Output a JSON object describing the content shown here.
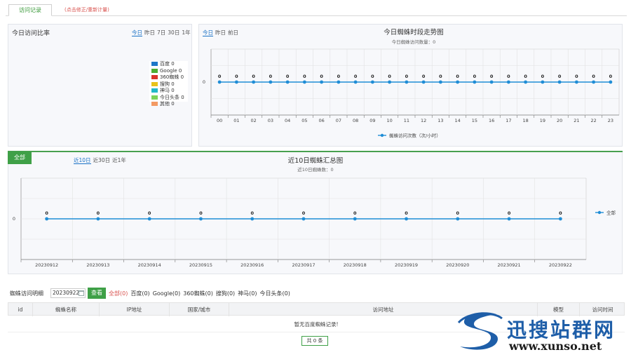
{
  "tabs": {
    "active": "访问记录",
    "link": "(点击修正/重新计量)"
  },
  "ratio": {
    "title": "今日访问比率",
    "range": [
      "今日",
      "昨日",
      "7日",
      "30日",
      "1年"
    ],
    "range_active": 0,
    "legend": [
      {
        "label": "百度 0",
        "color": "#1f78c8"
      },
      {
        "label": "Google 0",
        "color": "#4cae33"
      },
      {
        "label": "360蜘蛛 0",
        "color": "#d9342b"
      },
      {
        "label": "搜狗 0",
        "color": "#e8c21b"
      },
      {
        "label": "神马 0",
        "color": "#23b8c8"
      },
      {
        "label": "今日头条 0",
        "color": "#7dd35a"
      },
      {
        "label": "其他 0",
        "color": "#f39a63"
      }
    ]
  },
  "hourly": {
    "range": [
      "今日",
      "昨日",
      "前日"
    ],
    "range_active": 0,
    "chart_data": {
      "type": "line",
      "title": "今日蜘蛛时段走势图",
      "subtitle": "今日蜘蛛访问数量：0",
      "categories": [
        "00",
        "01",
        "02",
        "03",
        "04",
        "05",
        "06",
        "07",
        "08",
        "09",
        "10",
        "11",
        "12",
        "13",
        "14",
        "15",
        "16",
        "17",
        "18",
        "19",
        "20",
        "21",
        "22",
        "23"
      ],
      "series": [
        {
          "name": "蜘蛛访问次数（次/小时）",
          "values": [
            0,
            0,
            0,
            0,
            0,
            0,
            0,
            0,
            0,
            0,
            0,
            0,
            0,
            0,
            0,
            0,
            0,
            0,
            0,
            0,
            0,
            0,
            0,
            0
          ]
        }
      ],
      "yticks": [
        "0"
      ],
      "color": "#1f8dd6"
    }
  },
  "daily": {
    "tab": "全部",
    "range": [
      "近10日",
      "近30日",
      "近1年"
    ],
    "range_active": 0,
    "chart_data": {
      "type": "line",
      "title": "近10日蜘蛛汇总图",
      "subtitle": "近10日蜘蛛数：0",
      "categories": [
        "20230912",
        "20230913",
        "20230914",
        "20230915",
        "20230916",
        "20230917",
        "20230918",
        "20230919",
        "20230920",
        "20230921",
        "20230922"
      ],
      "series": [
        {
          "name": "全部",
          "values": [
            0,
            0,
            0,
            0,
            0,
            0,
            0,
            0,
            0,
            0,
            0
          ]
        }
      ],
      "yticks": [
        "0"
      ],
      "color": "#1f8dd6"
    }
  },
  "detail": {
    "label": "蜘蛛访问明细",
    "date": "20230922",
    "query": "查看",
    "filters": [
      "全部(0)",
      "百度(0)",
      "Google(0)",
      "360蜘蛛(0)",
      "搜狗(0)",
      "神马(0)",
      "今日头条(0)"
    ],
    "filter_active": 0,
    "columns": [
      "id",
      "蜘蛛名称",
      "IP地址",
      "国家/城市",
      "访问地址",
      "模型",
      "访问时间"
    ],
    "empty": "暂无百度蜘蛛记录!",
    "pager": "共 0 条"
  },
  "watermark": {
    "text": "迅搜站群网",
    "url": "www.xunso.net"
  }
}
